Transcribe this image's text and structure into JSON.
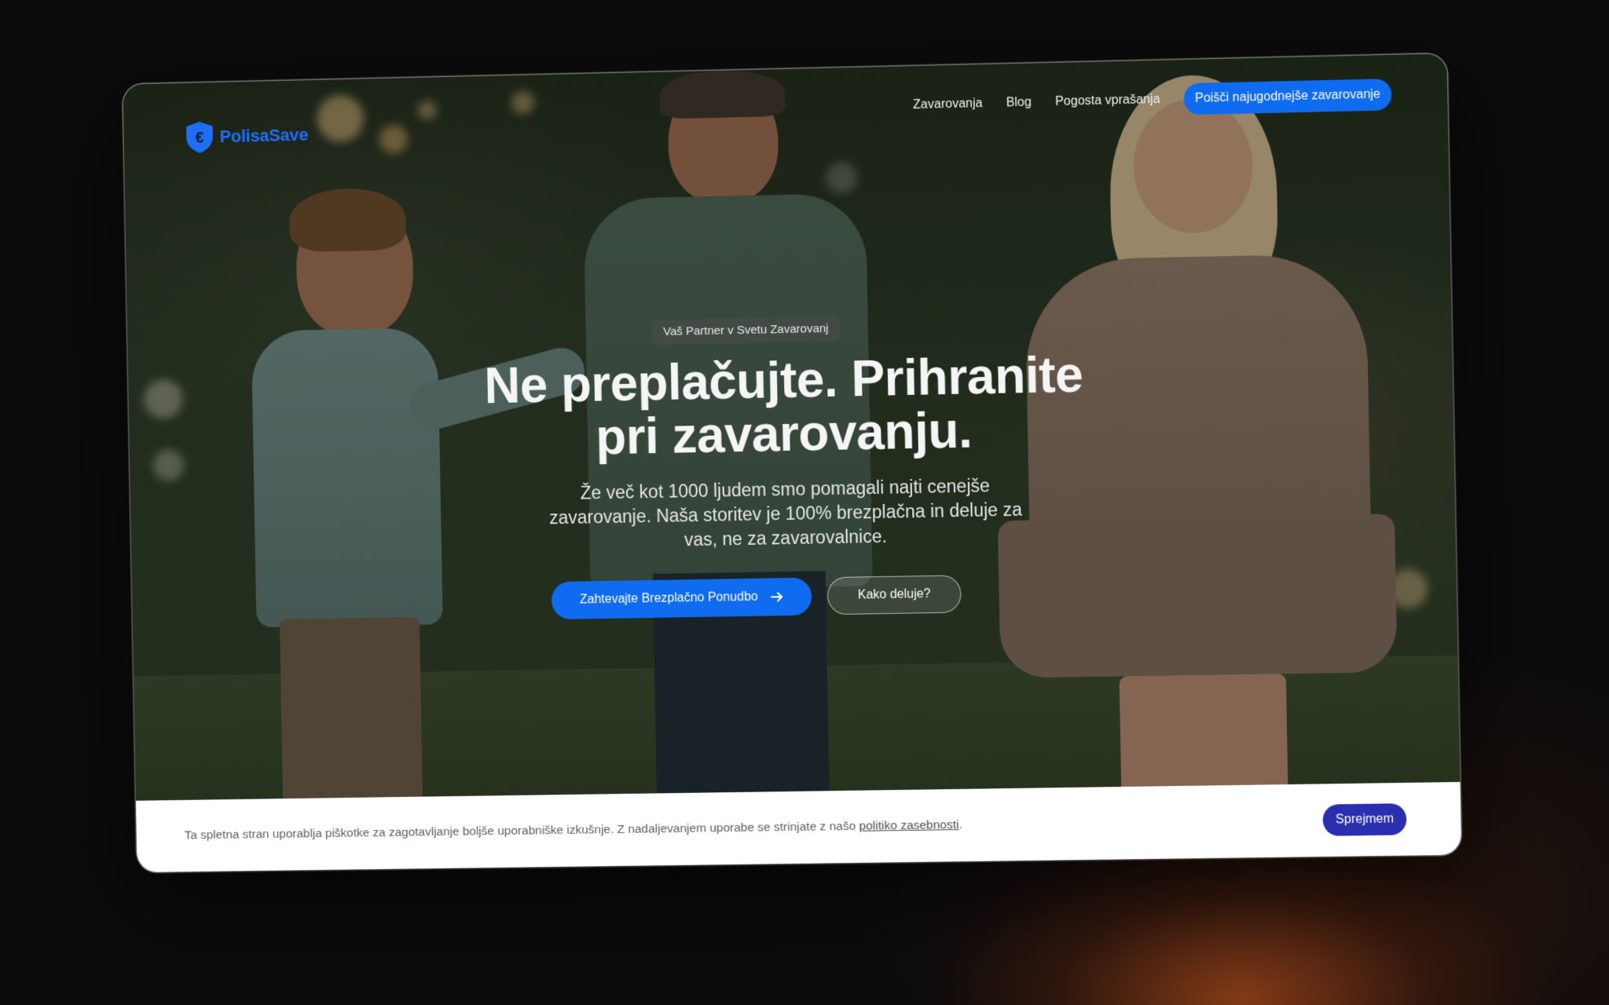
{
  "brand": {
    "name": "PolisaSave",
    "logo_icon": "euro-shield-icon",
    "color": "#1e6ff5"
  },
  "nav": {
    "links": [
      "Zavarovanja",
      "Blog",
      "Pogosta vprašanja"
    ],
    "cta_label": "Poišči najugodnejše zavarovanje"
  },
  "hero": {
    "badge": "Vaš Partner v Svetu Zavarovanj",
    "headline_line1": "Ne preplačujte. Prihranite",
    "headline_line2": "pri zavarovanju.",
    "subhead": "Že več kot 1000 ljudem smo pomagali najti cenejše zavarovanje. Naša storitev je 100% brezplačna in deluje za vas, ne za zavarovalnice.",
    "primary_button": "Zahtevajte Brezplačno Ponudbo",
    "primary_button_icon": "arrow-right-icon",
    "secondary_button": "Kako deluje?"
  },
  "cookie_banner": {
    "text": "Ta spletna stran uporablja piškotke za zagotavljanje boljše uporabniške izkušnje. Z nadaljevanjem uporabe se strinjate z našo ",
    "link_text": "politiko zasebnosti",
    "suffix": ".",
    "accept_button": "Sprejmem"
  },
  "colors": {
    "accent": "#0f6bf0",
    "cookie_button": "#2a2fb0"
  }
}
